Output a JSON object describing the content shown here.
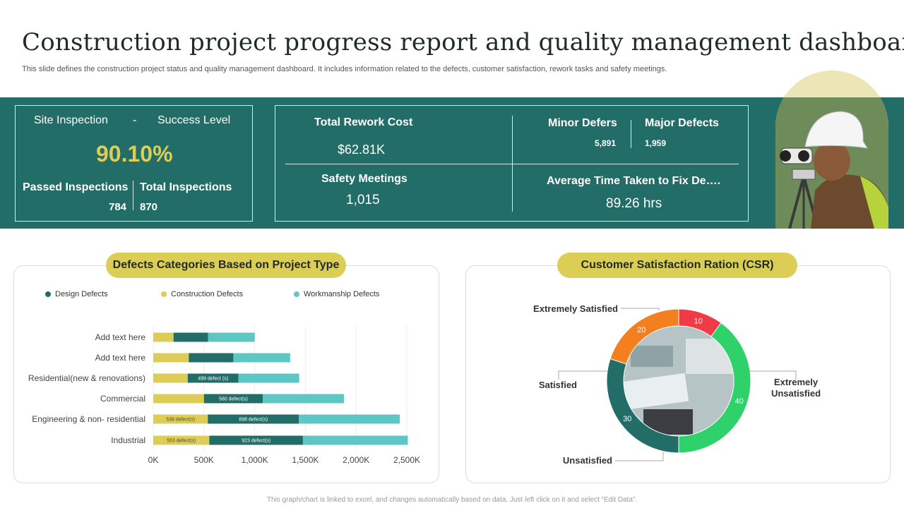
{
  "header": {
    "title": "Construction project progress report and quality management dashboard",
    "subtitle": "This slide defines the construction project status and quality management dashboard. It includes information related to the defects, customer satisfaction, rework tasks and safety meetings."
  },
  "kpi": {
    "site_inspection_label": "Site Inspection",
    "dash": "-",
    "success_level_label": "Success Level",
    "success_value": "90.10%",
    "passed_label": "Passed Inspections",
    "passed_value": "784",
    "total_label": "Total Inspections",
    "total_value": "870",
    "rework_label": "Total Rework Cost",
    "rework_value": "$62.81K",
    "minor_label": "Minor Defers",
    "minor_value": "5,891",
    "major_label": "Major Defects",
    "major_value": "1,959",
    "safety_label": "Safety Meetings",
    "safety_value": "1,015",
    "avg_label": "Average Time Taken to Fix De….",
    "avg_value": "89.26",
    "avg_unit": "hrs"
  },
  "bar_panel": {
    "heading": "Defects Categories Based on Project Type",
    "legend": [
      "Design Defects",
      "Construction Defects",
      "Workmanship Defects"
    ]
  },
  "csr_panel": {
    "heading": "Customer Satisfaction Ration (CSR)"
  },
  "footer": "This graph/chart is linked to excel, and changes automatically based on data. Just left click on it and select “Edit Data”.",
  "colors": {
    "teal_band": "#226d68",
    "design": "#236d68",
    "construction": "#ddcd58",
    "workmanship": "#5fc6c6",
    "accent_yellow": "#dccd55",
    "green": "#2fd16a",
    "red": "#ef3b46",
    "orange": "#f47f1e",
    "dark_teal": "#226d68"
  },
  "chart_data": [
    {
      "type": "bar",
      "orientation": "horizontal",
      "stacked": true,
      "categories": [
        "Add text here",
        "Add text here",
        "Residential(new & renovations)",
        "Commercial",
        "Engineering & non- residential",
        "Industrial"
      ],
      "series": [
        {
          "name": "Construction Defects",
          "values": [
            200,
            350,
            340,
            500,
            538,
            553
          ],
          "labels": [
            "",
            "",
            "",
            "",
            "538 defect(s)",
            "553 defect(s)"
          ]
        },
        {
          "name": "Design Defects",
          "values": [
            340,
            440,
            499,
            580,
            898,
            923
          ],
          "labels": [
            "",
            "",
            "499 defect (s)",
            "580 defect(s)",
            "898 defect(s)",
            "923 defect(s)"
          ]
        },
        {
          "name": "Workmanship Defects",
          "values": [
            460,
            560,
            600,
            800,
            995,
            1034
          ],
          "labels": [
            "",
            "",
            "",
            "",
            "",
            ""
          ]
        }
      ],
      "x_ticks": [
        "0K",
        "500K",
        "1,000K",
        "1,500K",
        "2,000K",
        "2,500K"
      ],
      "xlim": [
        0,
        2500
      ],
      "grid": true,
      "legend_position": "top"
    },
    {
      "type": "pie",
      "donut": true,
      "slices": [
        {
          "label": "Extremely Satisfied",
          "value": 10,
          "color": "#ef3b46"
        },
        {
          "label": "Extremely Unsatisfied",
          "value": 40,
          "color": "#2fd16a"
        },
        {
          "label": "Unsatisfied",
          "value": 30,
          "color": "#226d68"
        },
        {
          "label": "Satisfied",
          "value": 20,
          "color": "#f47f1e"
        }
      ]
    }
  ]
}
